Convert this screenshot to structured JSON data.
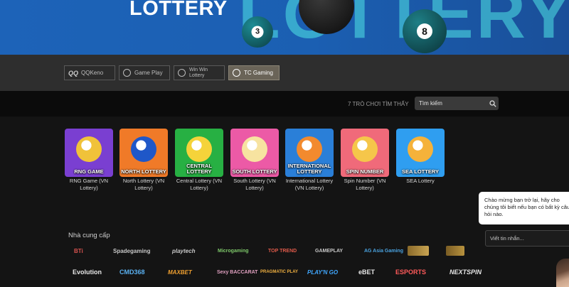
{
  "banner": {
    "title": "LOTTERY",
    "ghost": "LOTTERY",
    "balls": [
      {
        "number": "3",
        "color": "#0f5c63"
      },
      {
        "number": "8",
        "color": "#145a60"
      }
    ]
  },
  "provider_tabs": [
    {
      "label": "QQKeno",
      "active": false,
      "icon": "qq-logo-icon"
    },
    {
      "label": "Game Play",
      "active": false,
      "icon": "gameplay-logo-icon"
    },
    {
      "label": "Win Win\nLottery",
      "active": false,
      "icon": "winwin-logo-icon"
    },
    {
      "label": "TC Gaming",
      "active": true,
      "icon": "tc-gaming-logo-icon"
    }
  ],
  "search": {
    "result_count": "7 TRÒ CHƠI TÌM THẤY",
    "placeholder": "Tìm kiếm",
    "icon": "search-icon"
  },
  "games": [
    {
      "thumb_label": "RNG GAME",
      "name": "RNG Game (VN Lottery)",
      "bg": "#7a3fd1",
      "accent": "#f0c23a"
    },
    {
      "thumb_label": "NORTH LOTTERY",
      "name": "North Lottery (VN Lottery)",
      "bg": "#f07a28",
      "accent": "#1f57c8"
    },
    {
      "thumb_label": "CENTRAL LOTTERY",
      "name": "Central Lottery (VN Lottery)",
      "bg": "#27b043",
      "accent": "#f5d33a"
    },
    {
      "thumb_label": "SOUTH LOTTERY",
      "name": "South Lottery (VN Lottery)",
      "bg": "#ec5aa6",
      "accent": "#f7e3a0"
    },
    {
      "thumb_label": "INTERNATIONAL LOTTERY",
      "name": "International Lottery (VN Lottery)",
      "bg": "#2a7fd8",
      "accent": "#f28a2e"
    },
    {
      "thumb_label": "SPIN NUMBER",
      "name": "Spin Number (VN Lottery)",
      "bg": "#f06a7a",
      "accent": "#f5c64a"
    },
    {
      "thumb_label": "SEA LOTTERY",
      "name": "SEA Lottery",
      "bg": "#2f9ef0",
      "accent": "#f5b23a"
    }
  ],
  "providers": {
    "heading": "Nhà cung cấp",
    "row1": [
      "BTi",
      "Spadegaming",
      "playtech",
      "Microgaming",
      "TOP TREND",
      "GAMEPLAY",
      "AG Asia Gaming",
      "",
      ""
    ],
    "row2": [
      "Evolution",
      "CMD368",
      "MAXBET",
      "Sexy BACCARAT",
      "PRAGMATIC PLAY",
      "PLAY'N GO",
      "eBET",
      "ESPORTS",
      "NEXTSPIN"
    ]
  },
  "chat": {
    "message": "Chào mừng bạn trở lại, hãy cho chúng tôi biết nếu bạn có bất kỳ câu hỏi nào.",
    "input_placeholder": "Viết tin nhắn..."
  }
}
